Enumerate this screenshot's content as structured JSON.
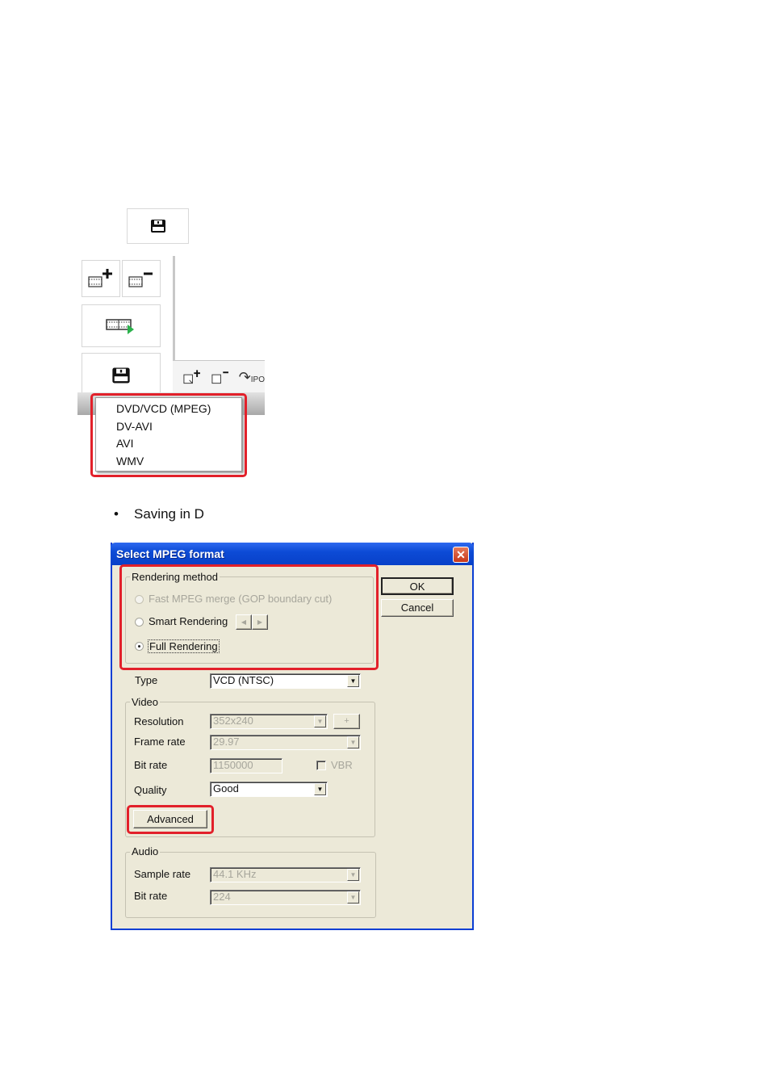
{
  "toolbar": {
    "icons": [
      "save-icon",
      "add-clip-icon",
      "remove-clip-icon",
      "export-film-icon",
      "save-icon",
      "add-page-icon",
      "remove-page-icon",
      "ipo-rotate-icon"
    ],
    "ipo_label": "IPO"
  },
  "save_menu": {
    "items": [
      "DVD/VCD (MPEG)",
      "DV-AVI",
      "AVI",
      "WMV"
    ]
  },
  "body_text": {
    "bullet": "•",
    "line": "Saving in D"
  },
  "dialog": {
    "title": "Select MPEG format",
    "close_symbol": "✕",
    "ok_label": "OK",
    "cancel_label": "Cancel",
    "rendering": {
      "group_label": "Rendering method",
      "options": [
        {
          "label": "Fast MPEG merge (GOP boundary cut)",
          "selected": false,
          "enabled": false
        },
        {
          "label": "Smart Rendering",
          "selected": false,
          "enabled": true
        },
        {
          "label": "Full Rendering",
          "selected": true,
          "enabled": true
        }
      ],
      "spin_left": "◀",
      "spin_right": "▶"
    },
    "type": {
      "label": "Type",
      "value": "VCD (NTSC)"
    },
    "video": {
      "group_label": "Video",
      "resolution": {
        "label": "Resolution",
        "value": "352x240",
        "plus": "+"
      },
      "frame_rate": {
        "label": "Frame rate",
        "value": "29.97"
      },
      "bit_rate": {
        "label": "Bit rate",
        "value": "1150000",
        "vbr_label": "VBR",
        "vbr_checked": false
      },
      "quality": {
        "label": "Quality",
        "value": "Good"
      },
      "advanced_label": "Advanced"
    },
    "audio": {
      "group_label": "Audio",
      "sample_rate": {
        "label": "Sample rate",
        "value": "44.1 KHz"
      },
      "bit_rate": {
        "label": "Bit rate",
        "value": "224"
      }
    },
    "dropdown_arrow": "▼"
  },
  "colors": {
    "highlight_red": "#e2202a",
    "dialog_blue": "#0a3ed4",
    "dialog_bg": "#ece9d8"
  }
}
